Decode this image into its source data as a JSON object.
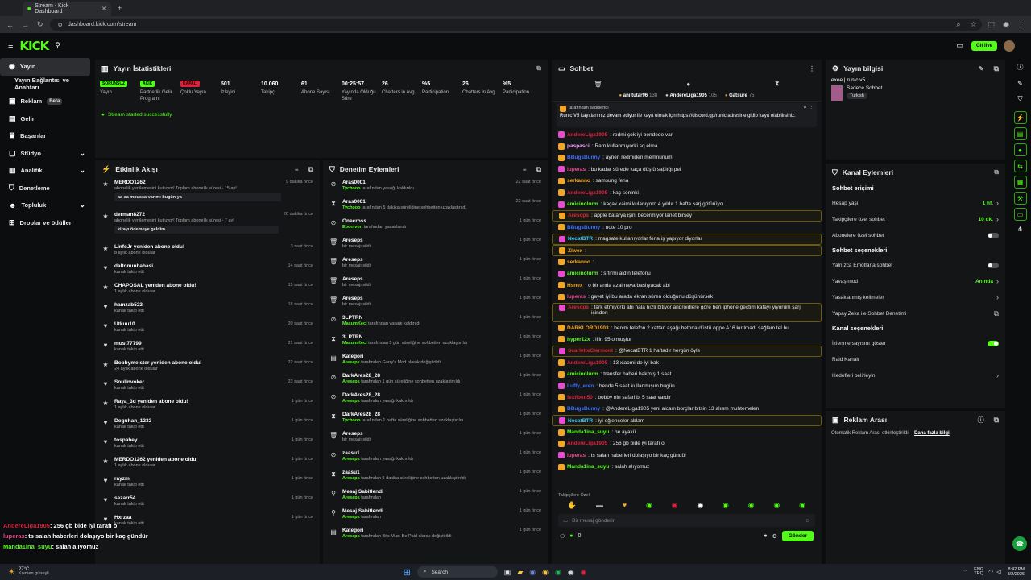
{
  "browser": {
    "tab_title": "Stream - Kick Dashboard",
    "url": "dashboard.kick.com/stream",
    "new_tab": "+"
  },
  "nav": {
    "logo": "KICK",
    "live_btn": "Git live"
  },
  "sidebar": [
    {
      "label": "Yayın"
    },
    {
      "label": "Yayın Bağlantısı ve Anahtarı"
    },
    {
      "label": "Reklam",
      "badge": "Beta"
    },
    {
      "label": "Gelir"
    },
    {
      "label": "Başarılar"
    },
    {
      "label": "Stüdyo"
    },
    {
      "label": "Analitik"
    },
    {
      "label": "Denetleme"
    },
    {
      "label": "Topluluk"
    },
    {
      "label": "Droplar ve ödüller"
    }
  ],
  "stats": {
    "title": "Yayın İstatistikleri",
    "items": [
      {
        "value": "SORUNSUZ",
        "label": "Yayın",
        "badge": "#53fc18"
      },
      {
        "value": "AÇIK",
        "label": "Partnerlik Gelir Programı",
        "badge": "#53fc18"
      },
      {
        "value": "KAPALI",
        "label": "Çoklu Yayın",
        "badge": "#e0213d"
      },
      {
        "value": "501",
        "label": "İzleyici"
      },
      {
        "value": "10.060",
        "label": "Takipçi"
      },
      {
        "value": "61",
        "label": "Abone Sayısı"
      },
      {
        "value": "00:25:57",
        "label": "Yayında Olduğu Süre"
      },
      {
        "value": "26",
        "label": "Chatters in Avg."
      },
      {
        "value": "%5",
        "label": "Participation"
      },
      {
        "value": "26",
        "label": "Chatters in Avg."
      },
      {
        "value": "%5",
        "label": "Participation"
      }
    ],
    "status": "Stream started successfully."
  },
  "activity": {
    "title": "Etkinlik Akışı",
    "items": [
      {
        "icon": "★",
        "name": "MERDO1262",
        "desc": "abonelik yenilemesini kutluyor! Toplam abonelik süresi - 15 ay!",
        "time": "9 dakika önce",
        "msg": "aa aa moussa var mı bugün ya"
      },
      {
        "icon": "★",
        "name": "derman8272",
        "desc": "abonelik yenilemesini kutluyor! Toplam abonelik süresi - 7 ay!",
        "time": "20 dakika önce",
        "msg": "kirayı ödemeye geldim"
      },
      {
        "icon": "★",
        "name": "LinfoJr yeniden abone oldu!",
        "desc": "8 aylık abone oldular",
        "time": "3 saat önce"
      },
      {
        "icon": "♥",
        "name": "daltonunbabasi",
        "desc": "kanalı takip etti",
        "time": "14 saat önce"
      },
      {
        "icon": "★",
        "name": "CHAPOSAL yeniden abone oldu!",
        "desc": "1 aylık abone oldular",
        "time": "15 saat önce"
      },
      {
        "icon": "♥",
        "name": "hamzab523",
        "desc": "kanalı takip etti",
        "time": "18 saat önce"
      },
      {
        "icon": "♥",
        "name": "Utkuu10",
        "desc": "kanalı takip etti",
        "time": "20 saat önce"
      },
      {
        "icon": "♥",
        "name": "must77799",
        "desc": "kanalı takip etti",
        "time": "21 saat önce"
      },
      {
        "icon": "★",
        "name": "Bobbymeister yeniden abone oldu!",
        "desc": "24 aylık abone oldular",
        "time": "22 saat önce"
      },
      {
        "icon": "♥",
        "name": "Soulinvoker",
        "desc": "kanalı takip etti",
        "time": "23 saat önce"
      },
      {
        "icon": "★",
        "name": "Raya_3d yeniden abone oldu!",
        "desc": "1 aylık abone oldular",
        "time": "1 gün önce"
      },
      {
        "icon": "♥",
        "name": "Doguhan_1232",
        "desc": "kanalı takip etti",
        "time": "1 gün önce"
      },
      {
        "icon": "♥",
        "name": "tospabey",
        "desc": "kanalı takip etti",
        "time": "1 gün önce"
      },
      {
        "icon": "★",
        "name": "MERDO1262 yeniden abone oldu!",
        "desc": "1 aylık abone oldular",
        "time": "1 gün önce"
      },
      {
        "icon": "♥",
        "name": "rayzm",
        "desc": "kanalı takip etti",
        "time": "1 gün önce"
      },
      {
        "icon": "♥",
        "name": "sezarr54",
        "desc": "kanalı takip etti",
        "time": "1 gün önce"
      },
      {
        "icon": "♥",
        "name": "Hxrzaa",
        "desc": "kanalı takip etti",
        "time": "1 gün önce"
      }
    ]
  },
  "moderation": {
    "title": "Denetim Eylemleri",
    "items": [
      {
        "icon": "⊘",
        "name": "Aras0001",
        "mod": "Tychooo",
        "desc": " tarafından yasağı kaldırıldı",
        "time": "22 saat önce"
      },
      {
        "icon": "⧗",
        "name": "Aras0001",
        "mod": "Tychooo",
        "desc": " tarafından 5 dakika süreliğine sohbetten uzaklaştırıldı",
        "time": "22 saat önce"
      },
      {
        "icon": "⊘",
        "name": "Onecross",
        "mod": "Ebonivon",
        "desc": " tarafından yasaklandı",
        "time": "1 gün önce"
      },
      {
        "icon": "🗑",
        "name": "Areseps",
        "mod": "",
        "desc": "bir mesajı sildi",
        "time": "1 gün önce"
      },
      {
        "icon": "🗑",
        "name": "Areseps",
        "mod": "",
        "desc": "bir mesajı sildi",
        "time": "1 gün önce"
      },
      {
        "icon": "🗑",
        "name": "Areseps",
        "mod": "",
        "desc": "bir mesajı sildi",
        "time": "1 gün önce"
      },
      {
        "icon": "🗑",
        "name": "Areseps",
        "mod": "",
        "desc": "bir mesajı sildi",
        "time": "1 gün önce"
      },
      {
        "icon": "⊘",
        "name": "3LPTRN",
        "mod": "MasumKeci",
        "desc": " tarafından yasağı kaldırıldı",
        "time": "1 gün önce"
      },
      {
        "icon": "⧗",
        "name": "3LPTRN",
        "mod": "MasumKeci",
        "desc": " tarafından 5 gün süreliğine sohbetten uzaklaştırıldı",
        "time": "1 gün önce"
      },
      {
        "icon": "▤",
        "name": "Kategori",
        "mod": "Areseps",
        "desc": " tarafından Garry's Mod olarak değiştirildi",
        "time": "1 gün önce"
      },
      {
        "icon": "⊘",
        "name": "DarkAres28_28",
        "mod": "Areseps",
        "desc": " tarafından 1 gün süreliğine sohbetten uzaklaştırıldı",
        "time": "1 gün önce"
      },
      {
        "icon": "⊘",
        "name": "DarkAres28_28",
        "mod": "Areseps",
        "desc": " tarafından yasağı kaldırıldı",
        "time": "1 gün önce"
      },
      {
        "icon": "⧗",
        "name": "DarkAres28_28",
        "mod": "Tychooo",
        "desc": " tarafından 1 hafta süreliğine sohbetten uzaklaştırıldı",
        "time": "1 gün önce"
      },
      {
        "icon": "🗑",
        "name": "Areseps",
        "mod": "",
        "desc": "bir mesajı sildi",
        "time": "1 gün önce"
      },
      {
        "icon": "⊘",
        "name": "zaasu1",
        "mod": "Areseps",
        "desc": " tarafından yasağı kaldırıldı",
        "time": "1 gün önce"
      },
      {
        "icon": "⧗",
        "name": "zaasu1",
        "mod": "Areseps",
        "desc": " tarafından 5 dakika süreliğine sohbetten uzaklaştırıldı",
        "time": "1 gün önce"
      },
      {
        "icon": "⚲",
        "name": "Mesaj Sabitlendi",
        "mod": "Areseps",
        "desc": " tarafından",
        "time": "1 gün önce"
      },
      {
        "icon": "⚲",
        "name": "Mesaj Sabitlendi",
        "mod": "Areseps",
        "desc": " tarafından",
        "time": "1 gün önce"
      },
      {
        "icon": "▤",
        "name": "Kategori",
        "mod": "Areseps",
        "desc": " tarafından Bits Must Be Paid olarak değiştirildi",
        "time": "1 gün önce"
      }
    ]
  },
  "chat": {
    "title": "Sohbet",
    "top": [
      {
        "name": "anıltutar96",
        "n": "138",
        "c": "#f5a623"
      },
      {
        "name": "AndereLiga1905",
        "n": "105",
        "c": "#cfcfcf"
      },
      {
        "name": "Gatsure",
        "n": "75",
        "c": "#d2893a"
      }
    ],
    "pinned_by": "tarafından sabitlendi",
    "pinned_text": "Runic V5 kayıtlarımız devam ediyor ile kayıt olmak için https://discord.gg/runic adresine gidip kayıt olabilirsiniz.",
    "lines": [
      {
        "u": "AndereLiga1905",
        "c": "#e0213d",
        "t": ": redmi çok iyi bendede var",
        "hl": false
      },
      {
        "u": "paspasci",
        "c": "#f5a0ff",
        "t": ": Ram kullanmıyorki sq elma"
      },
      {
        "u": "BBugsBunny",
        "c": "#3a6fff",
        "t": ": aynen redmiden memnunum"
      },
      {
        "u": "luperas",
        "c": "#e84b8a",
        "t": ": bu kadar sürede kaça düştü sağlığı pel"
      },
      {
        "u": "serkanno",
        "c": "#f5a623",
        "t": ": samsung fena"
      },
      {
        "u": "AndereLiga1905",
        "c": "#e0213d",
        "t": ": kaç seninki"
      },
      {
        "u": "amicinolurm",
        "c": "#53fc18",
        "t": ": kaçak xaimi kulanıyorn 4 yıldır 1 hafta şarj götürüyo"
      },
      {
        "u": "Aresops",
        "c": "#e0213d",
        "t": ": apple batarya işini becermiyor lanet birşey",
        "hl": true
      },
      {
        "u": "BBugsBunny",
        "c": "#3a6fff",
        "t": ": note 10 pro"
      },
      {
        "u": "NecatBTR",
        "c": "#3ac6ff",
        "t": ": magsafe kullanıyorlar fena iş yapıyor diyorlar",
        "hl": true
      },
      {
        "u": "Ziwex",
        "c": "#f5a623",
        "t": ":",
        "hl": true
      },
      {
        "u": "serkanno",
        "c": "#f5a623",
        "t": ":"
      },
      {
        "u": "amicinolurm",
        "c": "#53fc18",
        "t": ": sıfırmi aldın telefonu"
      },
      {
        "u": "Hsnex",
        "c": "#f5a623",
        "t": ": o bir anda azalmaya başlıyacak abi"
      },
      {
        "u": "luperas",
        "c": "#e84b8a",
        "t": ": gayet iyi bu arada ekran süren olduğunu düşünürsek"
      },
      {
        "u": "Aresops",
        "c": "#e0213d",
        "t": ": fark etmiyorki abi hala hızlı bitiyor androidlere göre ben iphone geçtim kafayı yiyorum şarj işinden",
        "hl": true
      },
      {
        "u": "DARKLORD1903",
        "c": "#f5a623",
        "t": ": benim telefon 2 kattan aşağı betona düştü oppo A16 kırılmadı sağlam tel bu"
      },
      {
        "u": "hyper12x",
        "c": "#53fc18",
        "t": ": iliin 95 olmuştur"
      },
      {
        "u": "ScarletteClermont",
        "c": "#e0213d",
        "t": ": @NecatBTR 1 haftadır hergün öyle",
        "hl": true
      },
      {
        "u": "AndereLiga1905",
        "c": "#e0213d",
        "t": ": 13 xiaomi de iyi bak"
      },
      {
        "u": "amicinolurm",
        "c": "#53fc18",
        "t": ": transfer haberi bakmış 1 saat"
      },
      {
        "u": "Luffy_eren",
        "c": "#3a6fff",
        "t": ": bende 5 saat kullanmışım bugün"
      },
      {
        "u": "fexiloen50",
        "c": "#e0213d",
        "t": ": bobby nin safari bi 5 saat vardır"
      },
      {
        "u": "BBugsBunny",
        "c": "#3a6fff",
        "t": ": @AndereLiga1905 yeni alcam borçlar bitsin 13 alırım muhtemelen"
      },
      {
        "u": "NecatBTR",
        "c": "#3ac6ff",
        "t": ": iyi eğlenceler ablam",
        "hl": true
      },
      {
        "u": "Manda1ina_suyu",
        "c": "#53fc18",
        "t": ": ne ayakü"
      },
      {
        "u": "AndereLiga1905",
        "c": "#e0213d",
        "t": ": 256 gb bide iyi tarafı o"
      },
      {
        "u": "luperas",
        "c": "#e84b8a",
        "t": ": ts salah haberleri dolaşıyo bir kaç gündür"
      },
      {
        "u": "Manda1ina_suyu",
        "c": "#53fc18",
        "t": ": salah alıyomuz"
      }
    ],
    "emote_label": "Takipçilere Özel",
    "input_placeholder": "Bir mesaj gönderin",
    "send": "Gönder",
    "count": "0"
  },
  "stream_info": {
    "title": "Yayın bilgisi",
    "stream_title": "exee | runic v5",
    "category": "Sadece Sohbet",
    "tag": "Turkish"
  },
  "channel_actions": {
    "title": "Kanal Eylemleri",
    "chat_access": "Sohbet erişimi",
    "account_age": "Hesap yaşı",
    "account_age_val": "1 hf.",
    "followers_only": "Takipçilere özel sohbet",
    "followers_only_val": "10 dk.",
    "subs_only": "Abonelere özel sohbet",
    "chat_options": "Sohbet seçenekleri",
    "emotes_only": "Yalnızca Emotlarla sohbet",
    "slow_mode": "Yavaş mod",
    "slow_val": "Anında",
    "banned_words": "Yasaklanmış kelimeler",
    "ai_mod": "Yapay Zeka ile Sohbet Denetimi",
    "channel_options": "Kanal seçenekleri",
    "show_viewers": "İzlenme sayısını göster",
    "raid": "Raid Kanalı",
    "targets": "Hedefleri belirleyin"
  },
  "ads": {
    "title": "Reklam Arası",
    "desc": "Otomatik Reklam Arası etkinleştirildi.",
    "link": "Daha fazla bilgi"
  },
  "overlay": [
    {
      "u": "AndereLiga1905",
      "t": ": 256 gb bide iyi tarafı o",
      "c": "#e0213d"
    },
    {
      "u": "luperas",
      "t": ": ts salah haberleri dolaşıyo bir kaç gündür",
      "c": "#e84b8a"
    },
    {
      "u": "Manda1ina_suyu",
      "t": ": salah alıyomuz",
      "c": "#53fc18"
    }
  ],
  "taskbar": {
    "weather": "27°C",
    "weather_desc": "Kısmen güneşli",
    "search": "Search",
    "lang": "ENG",
    "lang2": "TRQ",
    "time": "8:42 PM",
    "date": "8/2/2026"
  },
  "colors": {
    "accent": "#53fc18",
    "panel": "#131517",
    "bg": "#0b0d0e"
  }
}
